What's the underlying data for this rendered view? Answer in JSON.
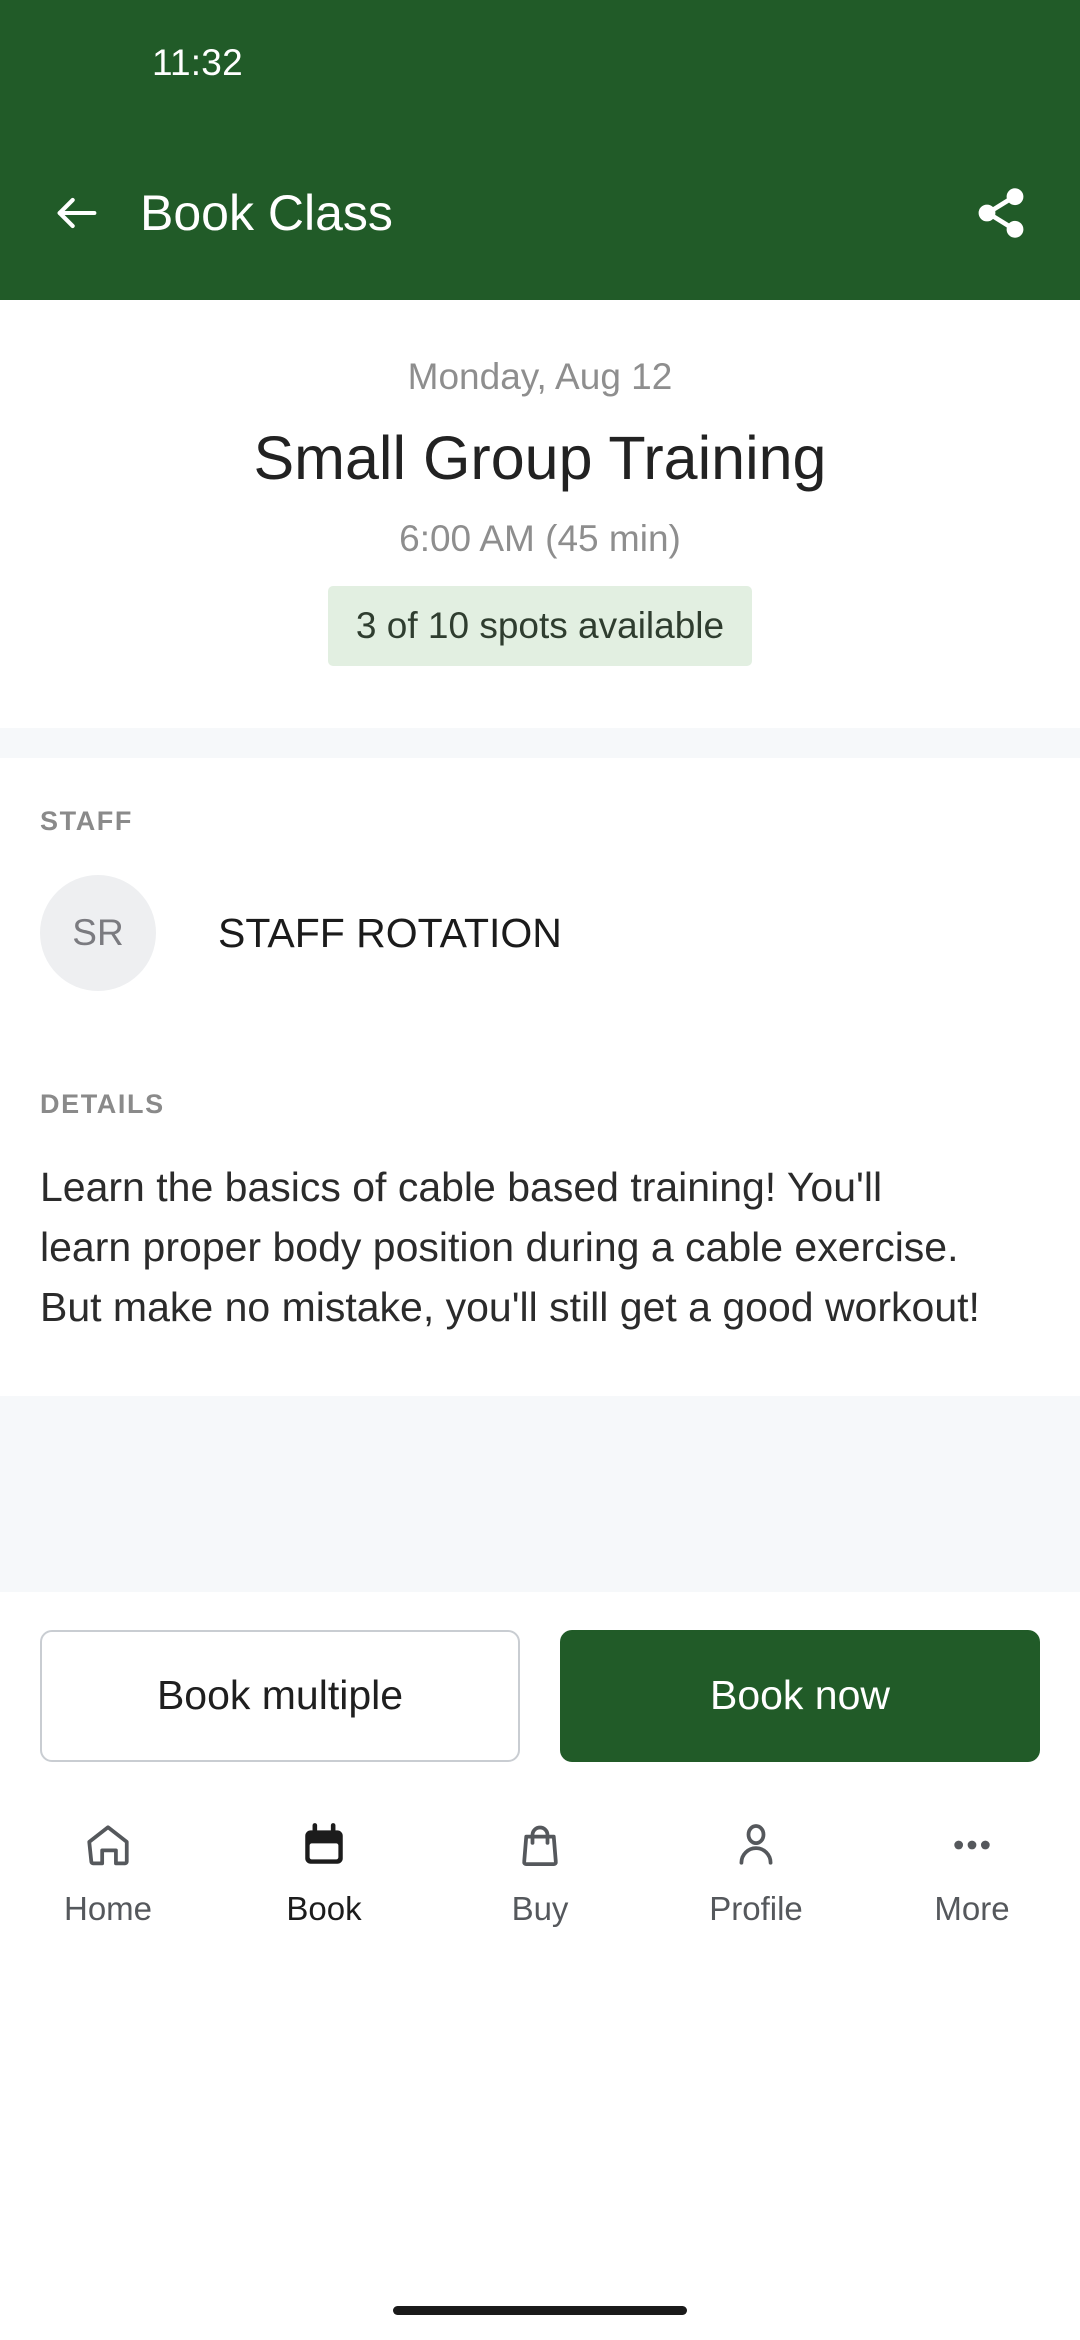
{
  "theme": {
    "brand_green": "#215b28",
    "badge_bg": "#e2efe1",
    "band_gray": "#f6f8fa"
  },
  "status_bar": {
    "clock": "11:32"
  },
  "appbar": {
    "title": "Book Class",
    "back_icon": "arrow-left-icon",
    "share_icon": "share-icon"
  },
  "class_summary": {
    "date": "Monday, Aug 12",
    "name": "Small Group Training",
    "time": "6:00 AM (45 min)",
    "spots": "3 of 10 spots available"
  },
  "staff_section": {
    "label": "STAFF",
    "avatar_initials": "SR",
    "name": "STAFF ROTATION"
  },
  "details_section": {
    "label": "DETAILS",
    "text": "Learn the basics of cable based training! You'll learn proper body position during a cable exercise. But make no mistake, you'll still get a good workout!"
  },
  "actions": {
    "secondary_label": "Book multiple",
    "primary_label": "Book now"
  },
  "bottom_nav": {
    "items": [
      {
        "label": "Home",
        "icon": "home-icon",
        "active": false
      },
      {
        "label": "Book",
        "icon": "calendar-icon",
        "active": true
      },
      {
        "label": "Buy",
        "icon": "shopping-bag-icon",
        "active": false
      },
      {
        "label": "Profile",
        "icon": "person-icon",
        "active": false
      },
      {
        "label": "More",
        "icon": "ellipsis-icon",
        "active": false
      }
    ]
  }
}
